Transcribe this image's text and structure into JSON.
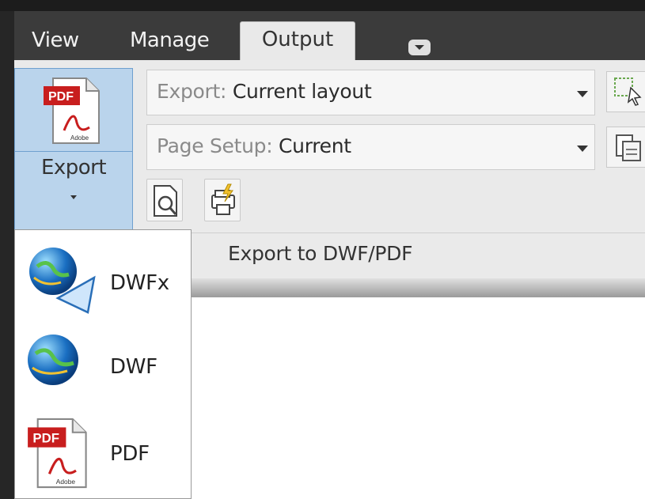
{
  "tabs": {
    "view": "View",
    "manage": "Manage",
    "output": "Output"
  },
  "export_button": {
    "label": "Export"
  },
  "combos": {
    "export": {
      "label": "Export:",
      "value": "Current layout"
    },
    "page_setup": {
      "label": "Page Setup:",
      "value": "Current"
    }
  },
  "panel": {
    "title": "Export to DWF/PDF"
  },
  "dropdown": {
    "items": [
      {
        "label": "DWFx",
        "icon": "dwfx-globe-icon"
      },
      {
        "label": "DWF",
        "icon": "dwf-globe-icon"
      },
      {
        "label": "PDF",
        "icon": "pdf-document-icon"
      }
    ]
  },
  "colors": {
    "accent": "#bad4ec",
    "ribbon_bg": "#eaeaea",
    "tab_bar": "#3b3b3b"
  }
}
